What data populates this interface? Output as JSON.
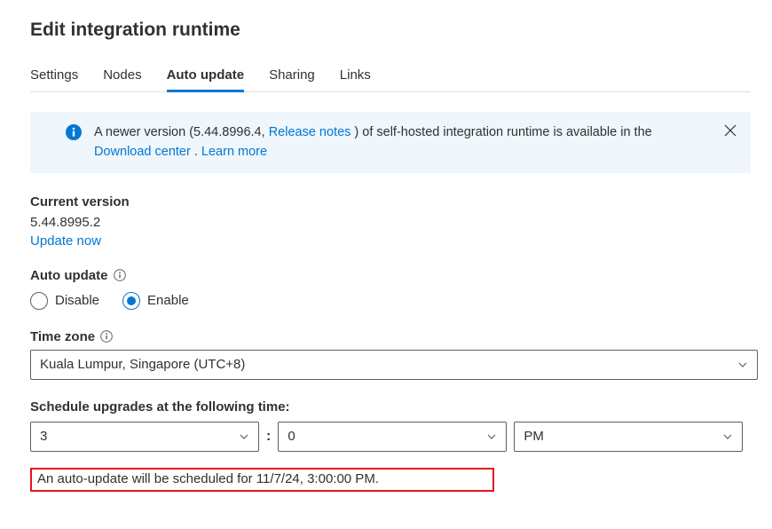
{
  "title": "Edit integration runtime",
  "tabs": [
    "Settings",
    "Nodes",
    "Auto update",
    "Sharing",
    "Links"
  ],
  "activeTab": 2,
  "banner": {
    "pre": "A newer version (5.44.8996.4, ",
    "releaseNotes": "Release notes",
    "mid1": " ) of self-hosted integration runtime is available in the ",
    "downloadCenter": "Download center",
    "mid2": " . ",
    "learnMore": "Learn more"
  },
  "currentVersion": {
    "label": "Current version",
    "value": "5.44.8995.2",
    "updateNow": "Update now"
  },
  "autoUpdate": {
    "label": "Auto update",
    "disable": "Disable",
    "enable": "Enable",
    "selected": "enable"
  },
  "timezone": {
    "label": "Time zone",
    "value": "Kuala Lumpur, Singapore (UTC+8)"
  },
  "schedule": {
    "label": "Schedule upgrades at the following time:",
    "hour": "3",
    "minute": "0",
    "ampm": "PM"
  },
  "scheduledMsg": "An auto-update will be scheduled for 11/7/24, 3:00:00 PM."
}
